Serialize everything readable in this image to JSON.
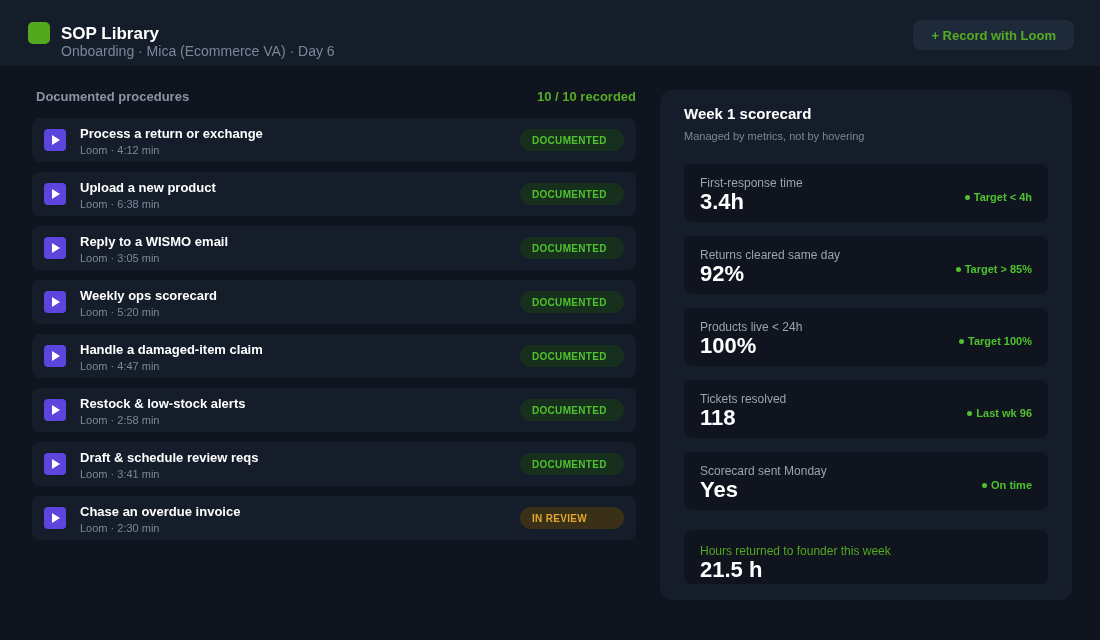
{
  "header": {
    "title": "SOP Library",
    "subtitle": "Onboarding · Mica (Ecommerce VA) · Day 6",
    "button": "+ Record with Loom"
  },
  "procedures": {
    "heading": "Documented procedures",
    "count": "10 / 10 recorded",
    "items": [
      {
        "title": "Process a return or exchange",
        "meta": "Loom · 4:12 min",
        "in_review": false,
        "badge": "DOCUMENTED"
      },
      {
        "title": "Upload a new product",
        "meta": "Loom · 6:38 min",
        "in_review": false,
        "badge": "DOCUMENTED"
      },
      {
        "title": "Reply to a WISMO email",
        "meta": "Loom · 3:05 min",
        "in_review": false,
        "badge": "DOCUMENTED"
      },
      {
        "title": "Weekly ops scorecard",
        "meta": "Loom · 5:20 min",
        "in_review": false,
        "badge": "DOCUMENTED"
      },
      {
        "title": "Handle a damaged-item claim",
        "meta": "Loom · 4:47 min",
        "in_review": false,
        "badge": "DOCUMENTED"
      },
      {
        "title": "Restock & low-stock alerts",
        "meta": "Loom · 2:58 min",
        "in_review": false,
        "badge": "DOCUMENTED"
      },
      {
        "title": "Draft & schedule review reqs",
        "meta": "Loom · 3:41 min",
        "in_review": false,
        "badge": "DOCUMENTED"
      },
      {
        "title": "Chase an overdue invoice",
        "meta": "Loom · 2:30 min",
        "in_review": true,
        "badge": "IN REVIEW"
      }
    ]
  },
  "scorecard": {
    "title": "Week 1 scorecard",
    "subtitle": "Managed by metrics, not by hovering",
    "metrics": [
      {
        "label": "First-response time",
        "value": "3.4h",
        "target": "Target < 4h"
      },
      {
        "label": "Returns cleared same day",
        "value": "92%",
        "target": "Target > 85%"
      },
      {
        "label": "Products live < 24h",
        "value": "100%",
        "target": "Target 100%"
      },
      {
        "label": "Tickets resolved",
        "value": "118",
        "target": "Last wk 96"
      },
      {
        "label": "Scorecard sent Monday",
        "value": "Yes",
        "target": "On time"
      }
    ],
    "summary": {
      "label": "Hours returned to founder this week",
      "value": "21.5 h"
    }
  }
}
